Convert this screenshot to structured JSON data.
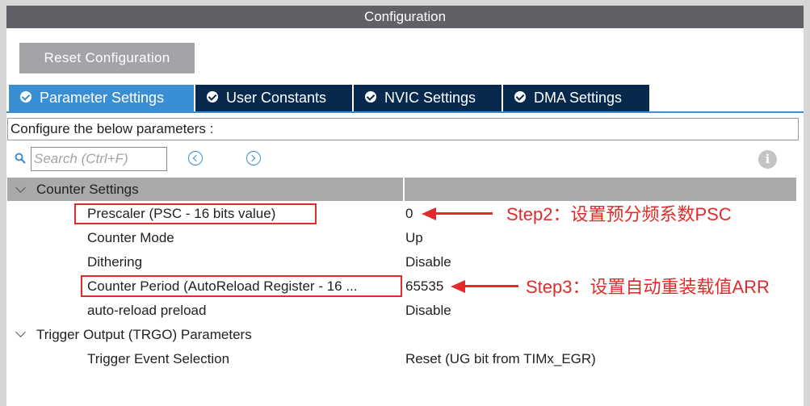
{
  "window": {
    "title": "Configuration"
  },
  "toolbar": {
    "reset_label": "Reset Configuration"
  },
  "tabs": [
    {
      "label": "Parameter Settings",
      "active": true,
      "icon": "check-circle-icon"
    },
    {
      "label": "User Constants",
      "active": false,
      "icon": "check-circle-icon"
    },
    {
      "label": "NVIC Settings",
      "active": false,
      "icon": "check-circle-icon"
    },
    {
      "label": "DMA Settings",
      "active": false,
      "icon": "check-circle-icon"
    }
  ],
  "description": "Configure the below parameters :",
  "search": {
    "placeholder": "Search (Ctrl+F)",
    "value": ""
  },
  "groups": [
    {
      "title": "Counter Settings",
      "expanded": true,
      "params": [
        {
          "name": "Prescaler (PSC - 16 bits value)",
          "value": "0"
        },
        {
          "name": "Counter Mode",
          "value": "Up"
        },
        {
          "name": "Dithering",
          "value": "Disable"
        },
        {
          "name": "Counter Period (AutoReload Register - 16 ...",
          "value": "65535"
        },
        {
          "name": "auto-reload preload",
          "value": "Disable"
        }
      ]
    },
    {
      "title": "Trigger Output (TRGO) Parameters",
      "expanded": true,
      "params": [
        {
          "name": "Trigger Event Selection",
          "value": "Reset (UG bit from TIMx_EGR)"
        }
      ]
    }
  ],
  "annotations": {
    "step2": "Step2：设置预分频系数PSC",
    "step3": "Step3：设置自动重装载值ARR"
  },
  "colors": {
    "titlebar": "#5f6166",
    "tab_active": "#3a8ed4",
    "tab_inactive": "#07294e",
    "annotation_red": "#e32a2a",
    "group_header": "#a9a9a9"
  }
}
